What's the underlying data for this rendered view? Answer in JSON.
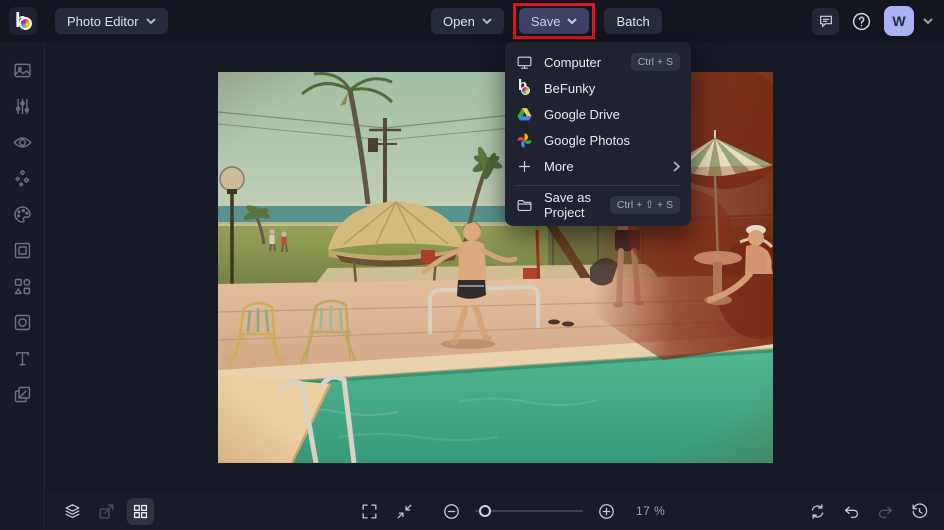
{
  "brand": {
    "logo_letter": "b"
  },
  "topbar": {
    "app_menu_label": "Photo Editor",
    "open_label": "Open",
    "save_label": "Save",
    "batch_label": "Batch",
    "avatar_initial": "W"
  },
  "save_menu": {
    "items": [
      {
        "icon": "computer-icon",
        "label": "Computer",
        "shortcut": "Ctrl + S"
      },
      {
        "icon": "befunky-icon",
        "label": "BeFunky",
        "shortcut": ""
      },
      {
        "icon": "google-drive-icon",
        "label": "Google Drive",
        "shortcut": ""
      },
      {
        "icon": "google-photos-icon",
        "label": "Google Photos",
        "shortcut": ""
      },
      {
        "icon": "plus-icon",
        "label": "More",
        "shortcut": "",
        "has_submenu": true
      }
    ],
    "project_item": {
      "icon": "folder-icon",
      "label": "Save as Project",
      "shortcut": "Ctrl + ⇧ + S"
    }
  },
  "sidebar": {
    "icons": [
      "image-icon",
      "sliders-icon",
      "eye-icon",
      "sparkles-icon",
      "palette-icon",
      "frame-icon",
      "shapes-icon",
      "overlay-icon",
      "text-icon",
      "layers-duo-icon"
    ]
  },
  "statusbar": {
    "zoom_percent": "17 %"
  },
  "colors": {
    "annotation_red": "#e3151c",
    "avatar_bg": "#a9b2f2",
    "save_active_bg": "#3e4266",
    "topbar_bg": "#13151f",
    "canvas_bg": "#161926",
    "dropdown_bg": "#1f2330"
  }
}
